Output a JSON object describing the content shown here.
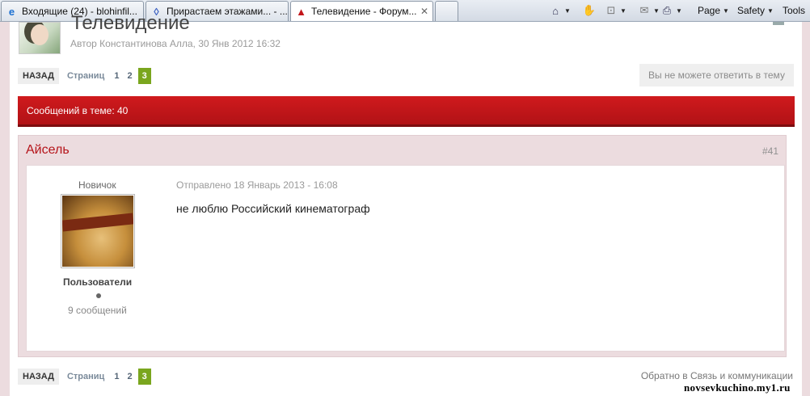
{
  "browser": {
    "tabs": [
      {
        "icon": "ie-icon",
        "label": "Входящие (24) - blohinfil..."
      },
      {
        "icon": "site-icon",
        "label": "Прирастаем этажами... - ..."
      },
      {
        "icon": "forum-icon",
        "label": "Телевидение - Форум..."
      }
    ],
    "commands": {
      "page": "Page",
      "safety": "Safety",
      "tools": "Tools"
    }
  },
  "topic": {
    "title": "Телевидение",
    "meta": "Автор Константинова Алла, 30 Янв 2012 16:32"
  },
  "pagination": {
    "back_label": "НАЗАД",
    "pages_label": "Страниц",
    "pages": [
      "1",
      "2",
      "3"
    ],
    "current": "3"
  },
  "reply_notice": "Вы не можете ответить в тему",
  "posts_in_topic": "Сообщений в теме: 40",
  "post": {
    "author": "Айсель",
    "number": "#41",
    "rank": "Новичок",
    "group": "Пользователи",
    "post_count": "9 сообщений",
    "date": "Отправлено 18 Январь 2013 - 16:08",
    "text": "не люблю Российский кинематограф"
  },
  "back_to_forum": "Обратно в Связь и коммуникации",
  "watermark": "novsevkuchino.my1.ru",
  "colors": {
    "accent_red": "#c3161a",
    "current_page": "#7aa61e"
  }
}
